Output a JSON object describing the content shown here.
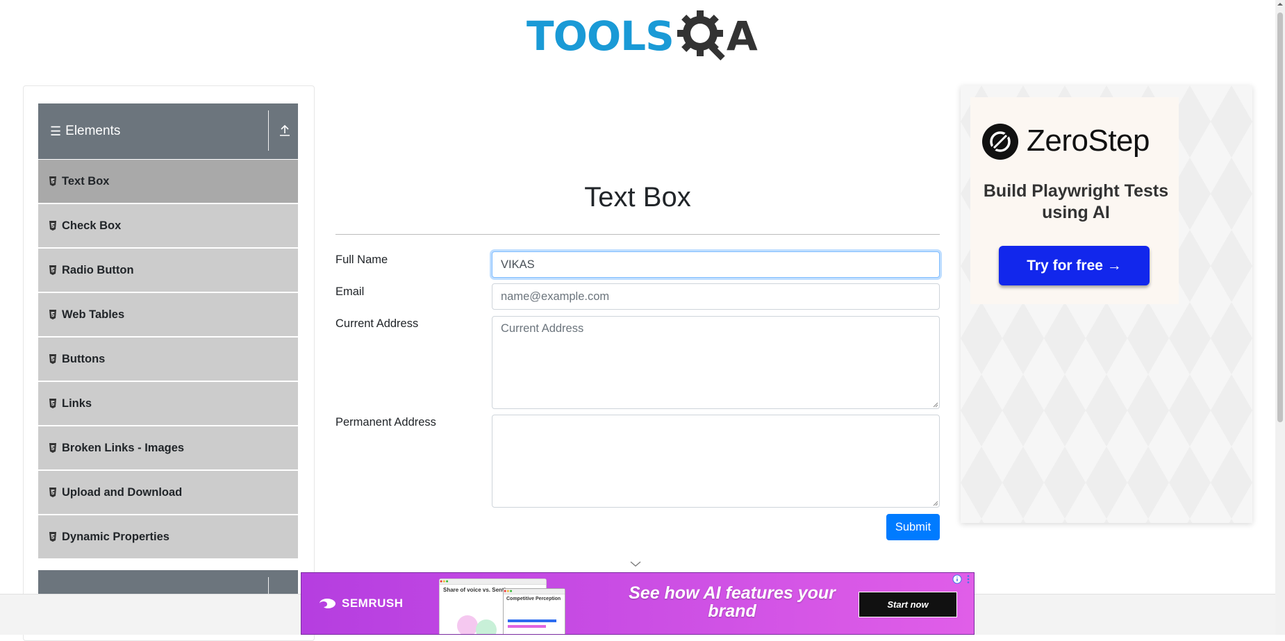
{
  "header": {
    "logo_text": "TOOLS",
    "logo_suffix": "A"
  },
  "sidebar": {
    "group_title": "Elements",
    "items": [
      {
        "label": "Text Box",
        "active": true
      },
      {
        "label": "Check Box"
      },
      {
        "label": "Radio Button"
      },
      {
        "label": "Web Tables"
      },
      {
        "label": "Buttons"
      },
      {
        "label": "Links"
      },
      {
        "label": "Broken Links - Images"
      },
      {
        "label": "Upload and Download"
      },
      {
        "label": "Dynamic Properties"
      }
    ]
  },
  "main": {
    "title": "Text Box",
    "full_name": {
      "label": "Full Name",
      "value": "VIKAS"
    },
    "email": {
      "label": "Email",
      "placeholder": "name@example.com"
    },
    "current_address": {
      "label": "Current Address",
      "placeholder": "Current Address"
    },
    "permanent_address": {
      "label": "Permanent Address",
      "placeholder": ""
    },
    "submit_label": "Submit"
  },
  "right_ad": {
    "brand": "ZeroStep",
    "tagline": "Build Playwright Tests using AI",
    "cta": "Try for free →"
  },
  "bottom_ad": {
    "brand": "SEMRUSH",
    "shot_title": "Share of voice vs. Sentim",
    "shot2_title": "Competitive Perception",
    "headline": "See how AI features your brand",
    "cta": "Start now"
  },
  "colors": {
    "accent": "#007bff",
    "sidebar_header": "#6c757d",
    "menu_item": "#cccccc",
    "menu_item_active": "#a9a9a9",
    "logo_blue": "#1a9ad6",
    "zerostep_button": "#1227ec"
  }
}
